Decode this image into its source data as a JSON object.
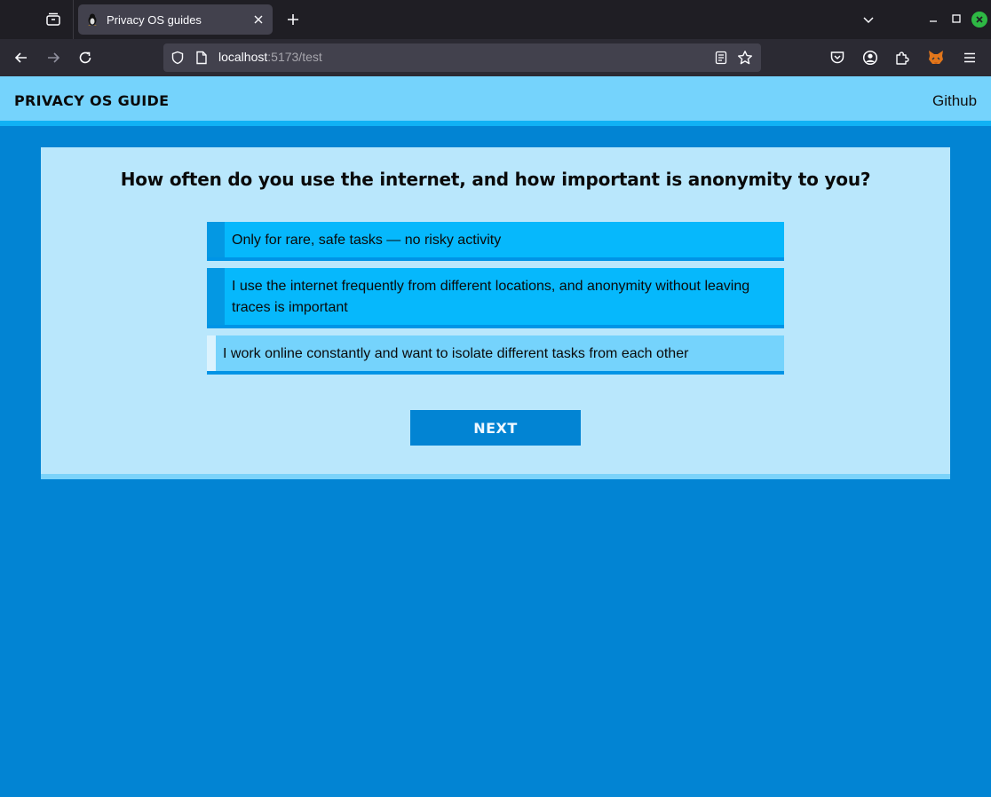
{
  "browser": {
    "tab_title": "Privacy OS guides",
    "url_host": "localhost",
    "url_rest": ":5173/test",
    "icons": {
      "tab_list": "tab-list-icon",
      "favicon": "penguin-icon",
      "tab_close": "close-icon",
      "new_tab": "plus-icon",
      "overflow": "chevron-down-icon",
      "back": "arrow-left-icon",
      "forward": "arrow-right-icon",
      "reload": "reload-icon",
      "shield": "shield-icon",
      "page": "page-icon",
      "reader": "reader-view-icon",
      "star": "star-icon",
      "pocket": "pocket-icon",
      "account": "account-icon",
      "extensions": "puzzle-icon",
      "metamask": "fox-icon",
      "menu": "hamburger-menu-icon"
    }
  },
  "site": {
    "brand": "PRIVACY OS GUIDE",
    "github": "Github",
    "colors": {
      "background": "#0284d3",
      "header": "#75d3fc",
      "card": "#b9e7fc",
      "option": "#06b8fc",
      "option_selected": "#75d3fc"
    }
  },
  "quiz": {
    "question": "How often do you use the internet, and how important is anonymity to you?",
    "options": [
      {
        "label": "Only for rare, safe tasks — no risky activity",
        "selected": false
      },
      {
        "label": "I use the internet frequently from different locations, and anonymity without leaving traces is important",
        "selected": false
      },
      {
        "label": "I work online constantly and want to isolate different tasks from each other",
        "selected": true
      }
    ],
    "next_label": "NEXT"
  }
}
